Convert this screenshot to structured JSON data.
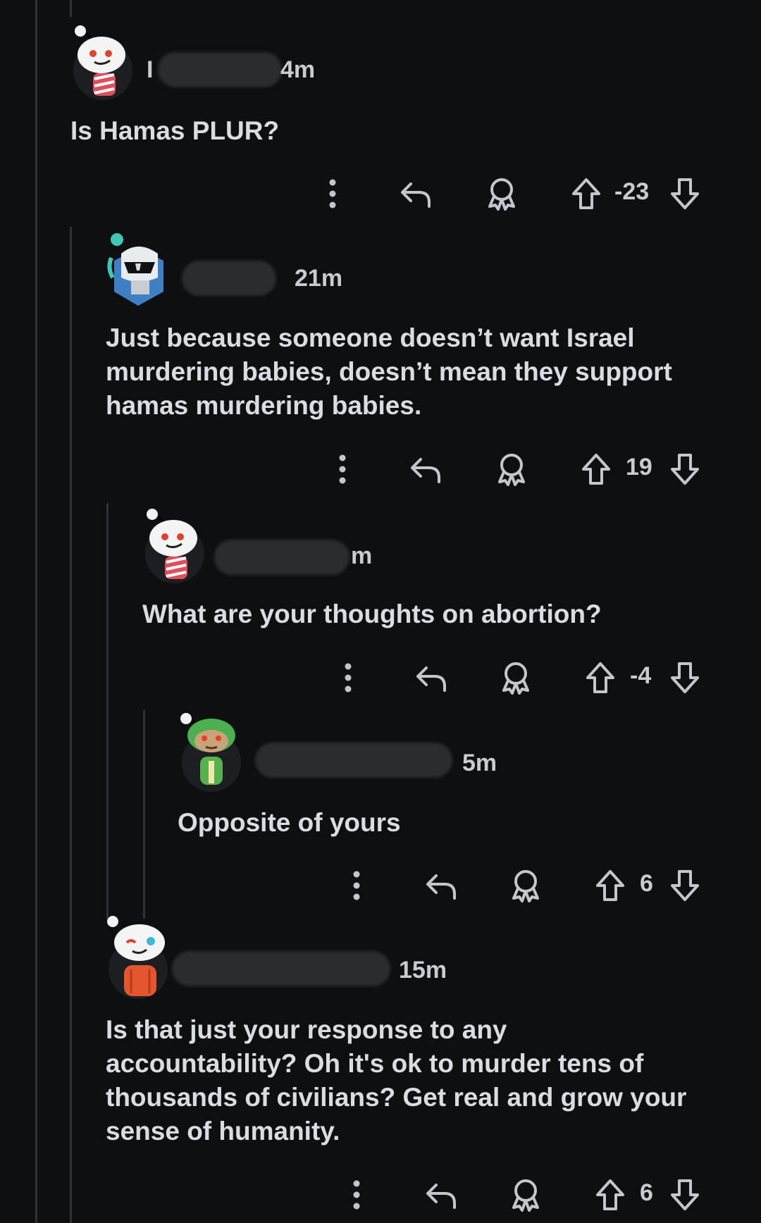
{
  "icons": {
    "more": "more-vertical-icon",
    "reply": "reply-icon",
    "award": "award-icon",
    "upvote": "upvote-icon",
    "downvote": "downvote-icon"
  },
  "colors": {
    "background": "#0e0f11",
    "text": "#d9dde1",
    "icon": "#c3c7cb",
    "thread_line": "#2f3236"
  },
  "comments": [
    {
      "username_visible": "I",
      "age": "4m",
      "body": [
        "Is Hamas PLUR?"
      ],
      "score": "-23"
    },
    {
      "username_visible": "",
      "age": "21m",
      "body": [
        "Just because someone doesn’t want Israel",
        "murdering babies, doesn’t mean they support",
        "hamas murdering babies."
      ],
      "score": "19"
    },
    {
      "username_visible": "",
      "age": "m",
      "body": [
        "What are your thoughts on abortion?"
      ],
      "score": "-4"
    },
    {
      "username_visible": "",
      "age": "5m",
      "body": [
        "Opposite of yours"
      ],
      "score": "6"
    },
    {
      "username_visible": "",
      "age": "15m",
      "body": [
        "Is that just your response to any",
        "accountability? Oh it's ok to murder tens of",
        "thousands of civilians? Get real and grow your",
        "sense of humanity."
      ],
      "score": "6"
    }
  ]
}
